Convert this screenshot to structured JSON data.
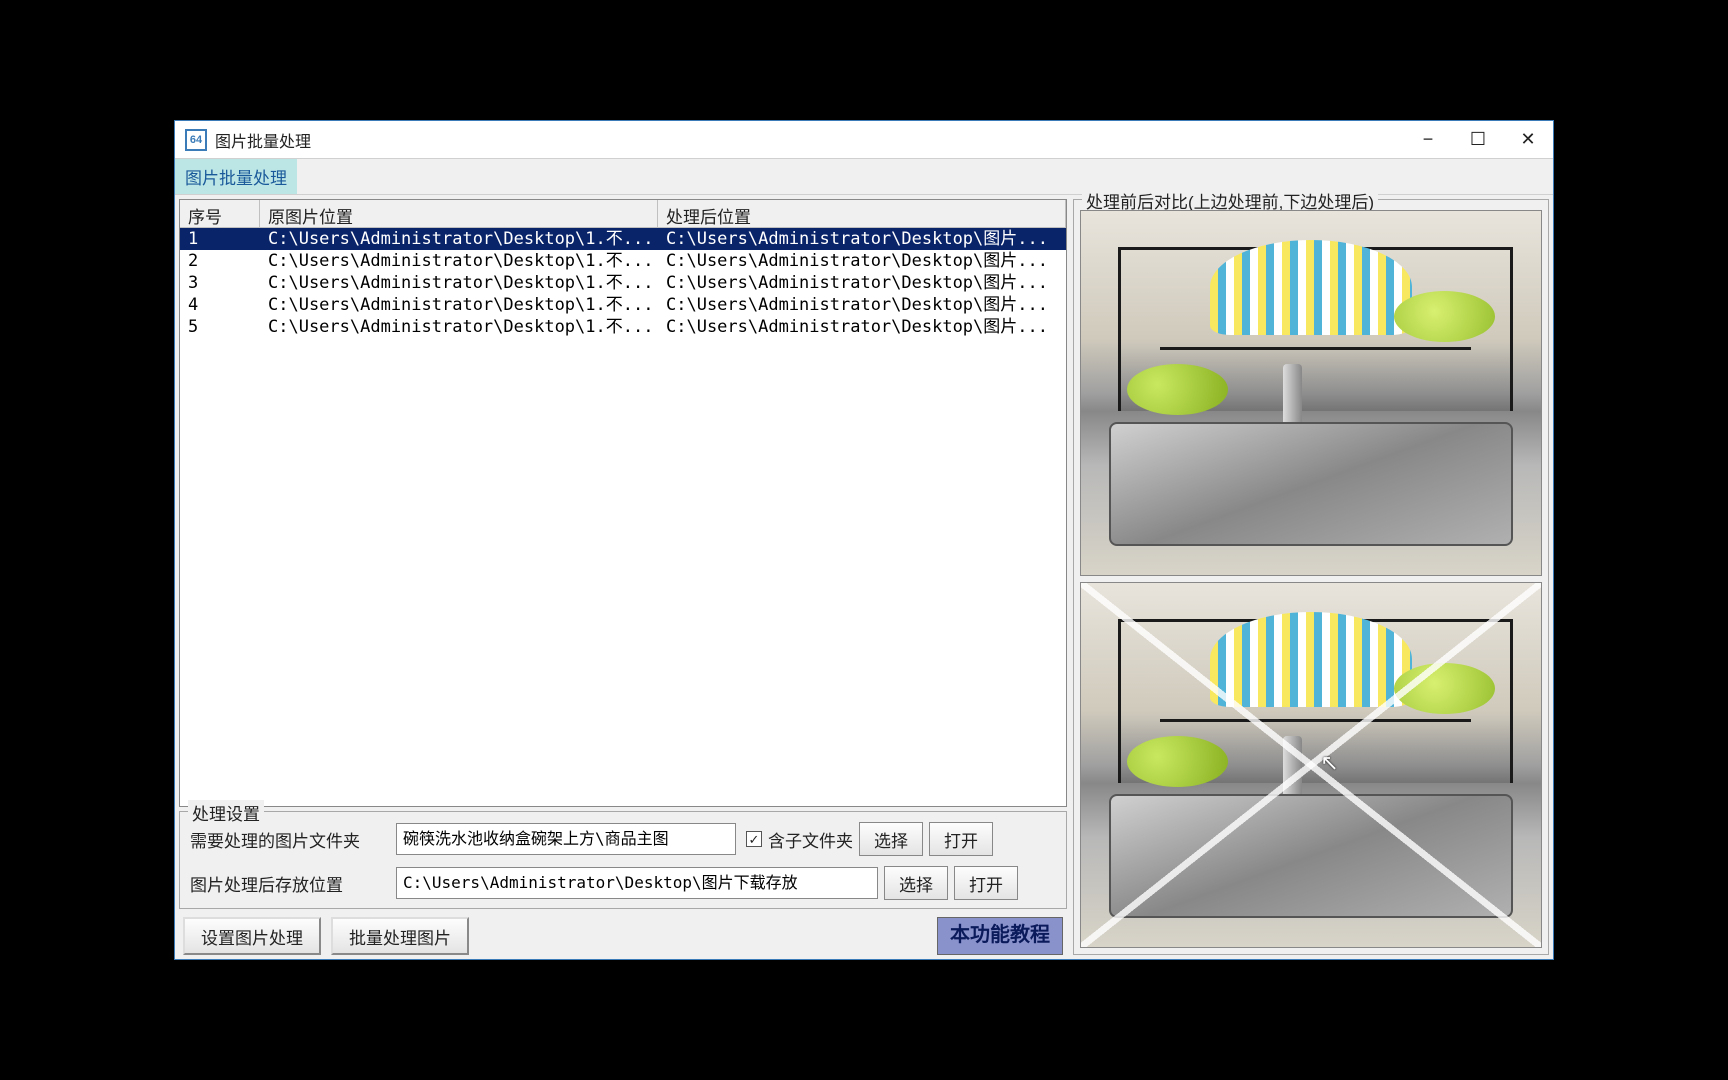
{
  "window": {
    "icon_text": "64",
    "title": "图片批量处理",
    "min_label": "−",
    "max_label": "☐",
    "close_label": "✕"
  },
  "menu": {
    "main_item": "图片批量处理"
  },
  "list": {
    "col_seq": "序号",
    "col_src": "原图片位置",
    "col_dst": "处理后位置",
    "rows": [
      {
        "seq": "1",
        "src": "C:\\Users\\Administrator\\Desktop\\1.不...",
        "dst": "C:\\Users\\Administrator\\Desktop\\图片..."
      },
      {
        "seq": "2",
        "src": "C:\\Users\\Administrator\\Desktop\\1.不...",
        "dst": "C:\\Users\\Administrator\\Desktop\\图片..."
      },
      {
        "seq": "3",
        "src": "C:\\Users\\Administrator\\Desktop\\1.不...",
        "dst": "C:\\Users\\Administrator\\Desktop\\图片..."
      },
      {
        "seq": "4",
        "src": "C:\\Users\\Administrator\\Desktop\\1.不...",
        "dst": "C:\\Users\\Administrator\\Desktop\\图片..."
      },
      {
        "seq": "5",
        "src": "C:\\Users\\Administrator\\Desktop\\1.不...",
        "dst": "C:\\Users\\Administrator\\Desktop\\图片..."
      }
    ],
    "selected_index": 0
  },
  "settings": {
    "legend": "处理设置",
    "src_label": "需要处理的图片文件夹",
    "src_value": "碗筷洗水池收纳盒碗架上方\\商品主图",
    "include_sub_label": "含子文件夹",
    "include_sub_checked": true,
    "select_btn": "选择",
    "open_btn": "打开",
    "dst_label": "图片处理后存放位置",
    "dst_value": "C:\\Users\\Administrator\\Desktop\\图片下载存放"
  },
  "actions": {
    "set_processing": "设置图片处理",
    "batch_process": "批量处理图片",
    "tutorial": "本功能教程"
  },
  "preview": {
    "legend": "处理前后对比(上边处理前,下边处理后)"
  }
}
